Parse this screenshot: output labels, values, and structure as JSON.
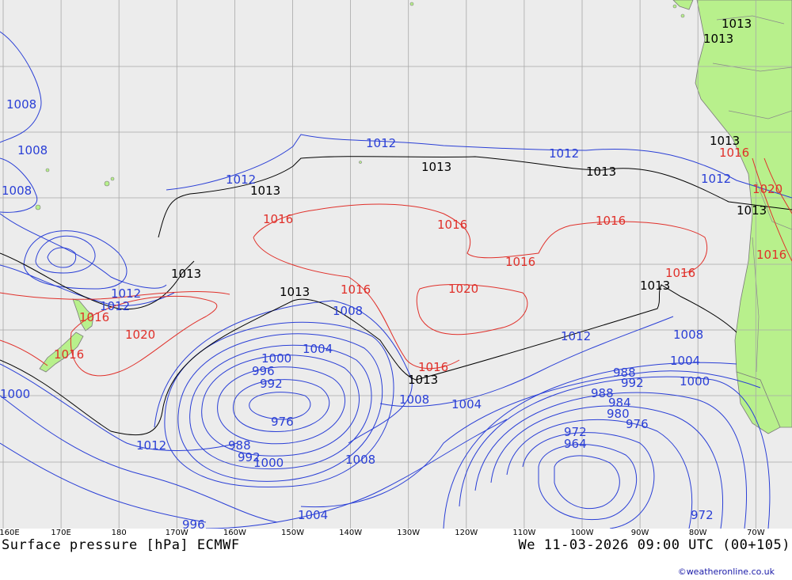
{
  "map": {
    "title": "Surface pressure [hPa] ECMWF",
    "valid_time": "We 11-03-2026 09:00 UTC (00+105)",
    "credit": "©weatheronline.co.uk",
    "colors": {
      "ocean": "#ececec",
      "land": "#b8f08c",
      "grid": "#a8a8a8",
      "low_isobar": "#2a3fd6",
      "high_isobar": "#e0302a",
      "standard_isobar": "#000000"
    },
    "longitude_labels": [
      "160E",
      "170E",
      "180",
      "170W",
      "160W",
      "150W",
      "140W",
      "130W",
      "120W",
      "110W",
      "100W",
      "90W",
      "80W",
      "70W"
    ],
    "isobar_labels": {
      "low": [
        "1008",
        "1008",
        "1008",
        "1012",
        "1012",
        "1012",
        "1012",
        "1012",
        "1012",
        "1008",
        "1004",
        "1000",
        "996",
        "992",
        "988",
        "984",
        "980",
        "976",
        "972",
        "1004",
        "1008",
        "1012",
        "1004",
        "1000",
        "996",
        "992",
        "988",
        "984",
        "980",
        "976",
        "972",
        "1004",
        "1008",
        "1000",
        "996",
        "1008",
        "988",
        "992",
        "1000",
        "1012",
        "972",
        "964",
        "1008"
      ],
      "standard": [
        "1013",
        "1013",
        "1013",
        "1013",
        "1013",
        "1013",
        "1013",
        "1013",
        "1013",
        "1013"
      ],
      "high": [
        "1016",
        "1016",
        "1016",
        "1016",
        "1016",
        "1020",
        "1016",
        "1016",
        "1020",
        "1016",
        "1016",
        "1020",
        "1016",
        "1016"
      ]
    }
  }
}
